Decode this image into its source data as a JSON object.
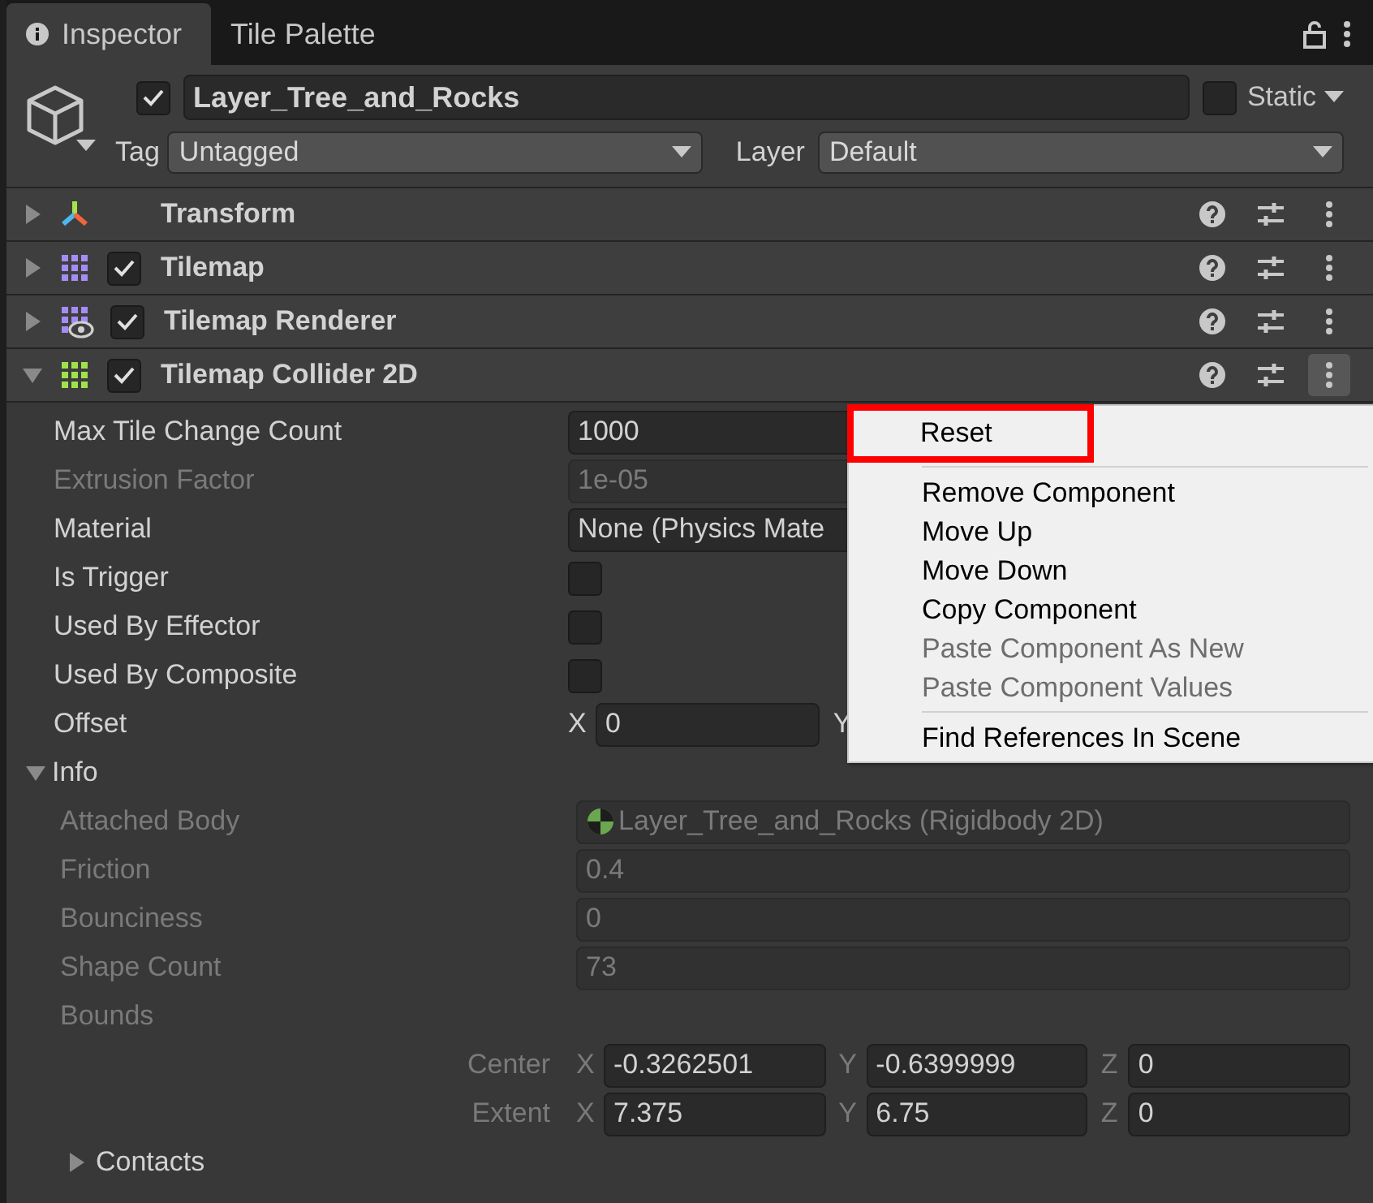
{
  "tabs": [
    {
      "label": "Inspector",
      "selected": true
    },
    {
      "label": "Tile Palette",
      "selected": false
    }
  ],
  "object": {
    "active": true,
    "name": "Layer_Tree_and_Rocks",
    "static_label": "Static",
    "static": false,
    "tag_label": "Tag",
    "tag": "Untagged",
    "layer_label": "Layer",
    "layer": "Default"
  },
  "components": [
    {
      "kind": "transform",
      "name": "Transform",
      "expanded": false,
      "menu_open": false
    },
    {
      "kind": "tilemap",
      "name": "Tilemap",
      "enabled": true,
      "expanded": false,
      "menu_open": false
    },
    {
      "kind": "renderer",
      "name": "Tilemap Renderer",
      "enabled": true,
      "expanded": false,
      "menu_open": false
    },
    {
      "kind": "collider",
      "name": "Tilemap Collider 2D",
      "enabled": true,
      "expanded": true,
      "menu_open": true
    }
  ],
  "properties": [
    {
      "kind": "field",
      "label": "Max Tile Change Count",
      "value": "1000",
      "disabled": false
    },
    {
      "kind": "field",
      "label": "Extrusion Factor",
      "value": "1e-05",
      "disabled": true
    },
    {
      "kind": "field",
      "label": "Material",
      "value": "None (Physics Mate",
      "disabled": false
    },
    {
      "kind": "checkbox",
      "label": "Is Trigger",
      "checked": false
    },
    {
      "kind": "checkbox",
      "label": "Used By Effector",
      "checked": false
    },
    {
      "kind": "checkbox",
      "label": "Used By Composite",
      "checked": false
    },
    {
      "kind": "vector",
      "label": "Offset",
      "components": [
        {
          "axis": "X",
          "value": "0"
        },
        {
          "axis": "Y"
        }
      ]
    }
  ],
  "info": {
    "label": "Info",
    "expanded": true,
    "rows": [
      {
        "kind": "object",
        "label": "Attached Body",
        "value": "Layer_Tree_and_Rocks (Rigidbody 2D)"
      },
      {
        "kind": "field",
        "label": "Friction",
        "value": "0.4"
      },
      {
        "kind": "field",
        "label": "Bounciness",
        "value": "0"
      },
      {
        "kind": "field",
        "label": "Shape Count",
        "value": "73"
      },
      {
        "kind": "heading",
        "label": "Bounds"
      },
      {
        "kind": "vector",
        "label": "Center",
        "components": [
          {
            "axis": "X",
            "value": "-0.3262501"
          },
          {
            "axis": "Y",
            "value": "-0.6399999"
          },
          {
            "axis": "Z",
            "value": "0"
          }
        ]
      },
      {
        "kind": "vector",
        "label": "Extent",
        "components": [
          {
            "axis": "X",
            "value": "7.375"
          },
          {
            "axis": "Y",
            "value": "6.75"
          },
          {
            "axis": "Z",
            "value": "0"
          }
        ]
      }
    ],
    "contacts": {
      "label": "Contacts",
      "expanded": false
    }
  },
  "context_menu": [
    {
      "label": "Reset",
      "disabled": false,
      "highlighted": true,
      "separator_before": false
    },
    {
      "label": "Remove Component",
      "disabled": false,
      "highlighted": false,
      "separator_before": true
    },
    {
      "label": "Move Up",
      "disabled": false,
      "highlighted": false,
      "separator_before": false
    },
    {
      "label": "Move Down",
      "disabled": false,
      "highlighted": false,
      "separator_before": false
    },
    {
      "label": "Copy Component",
      "disabled": false,
      "highlighted": false,
      "separator_before": false
    },
    {
      "label": "Paste Component As New",
      "disabled": true,
      "highlighted": false,
      "separator_before": false
    },
    {
      "label": "Paste Component Values",
      "disabled": true,
      "highlighted": false,
      "separator_before": false
    },
    {
      "label": "Find References In Scene",
      "disabled": false,
      "highlighted": false,
      "separator_before": true
    }
  ]
}
